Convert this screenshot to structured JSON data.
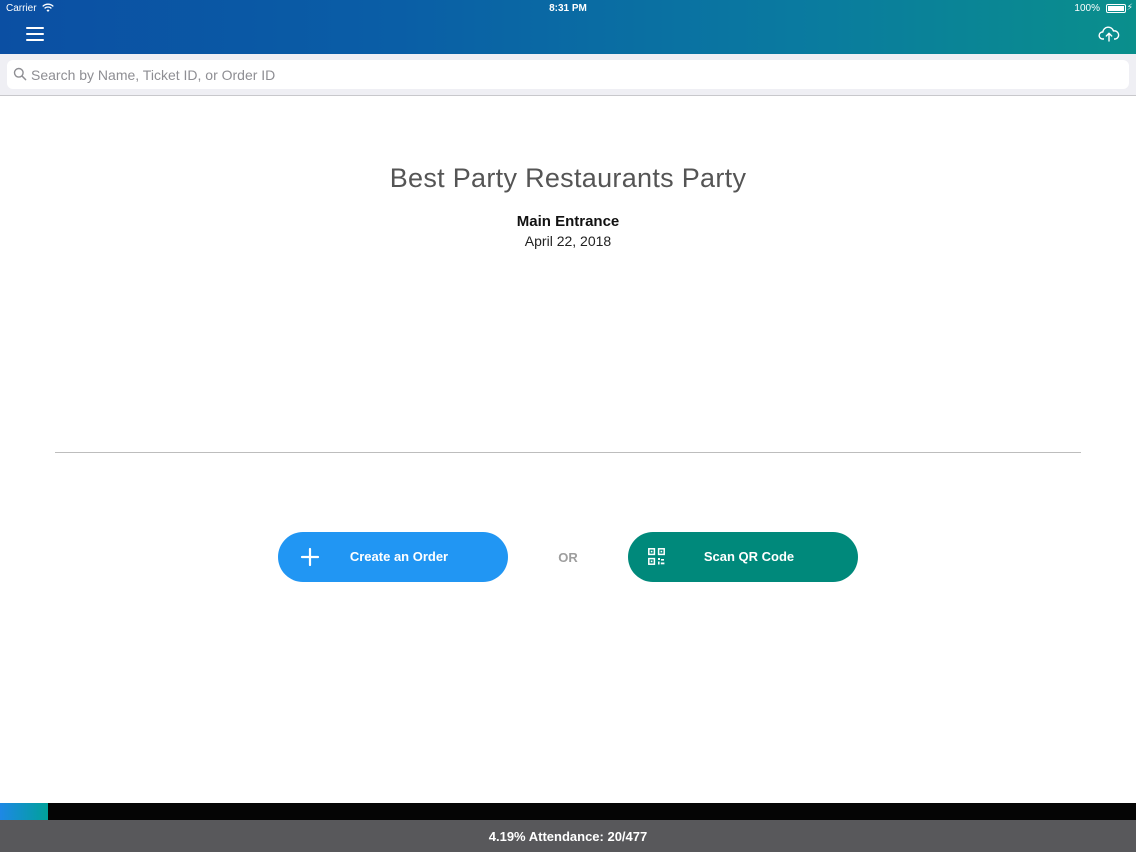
{
  "status_bar": {
    "carrier": "Carrier",
    "time": "8:31 PM",
    "battery": "100%"
  },
  "nav": {
    "menu_icon": "hamburger-menu-icon",
    "sync_icon": "cloud-upload-icon"
  },
  "search": {
    "placeholder": "Search by Name, Ticket ID, or Order ID",
    "value": ""
  },
  "event": {
    "title": "Best Party Restaurants Party",
    "location": "Main Entrance",
    "date": "April 22, 2018"
  },
  "actions": {
    "create_label": "Create an Order",
    "create_icon": "plus-icon",
    "or_label": "OR",
    "scan_label": "Scan QR Code",
    "scan_icon": "qr-code-icon"
  },
  "attendance": {
    "text": "4.19% Attendance: 20/477",
    "percent": 4.19,
    "checked_in": 20,
    "total": 477
  },
  "colors": {
    "header_start": "#0b4fa3",
    "header_end": "#0a8f8c",
    "create_button": "#2196f3",
    "scan_button": "#00897b",
    "attendance_bar": "#58585b"
  }
}
